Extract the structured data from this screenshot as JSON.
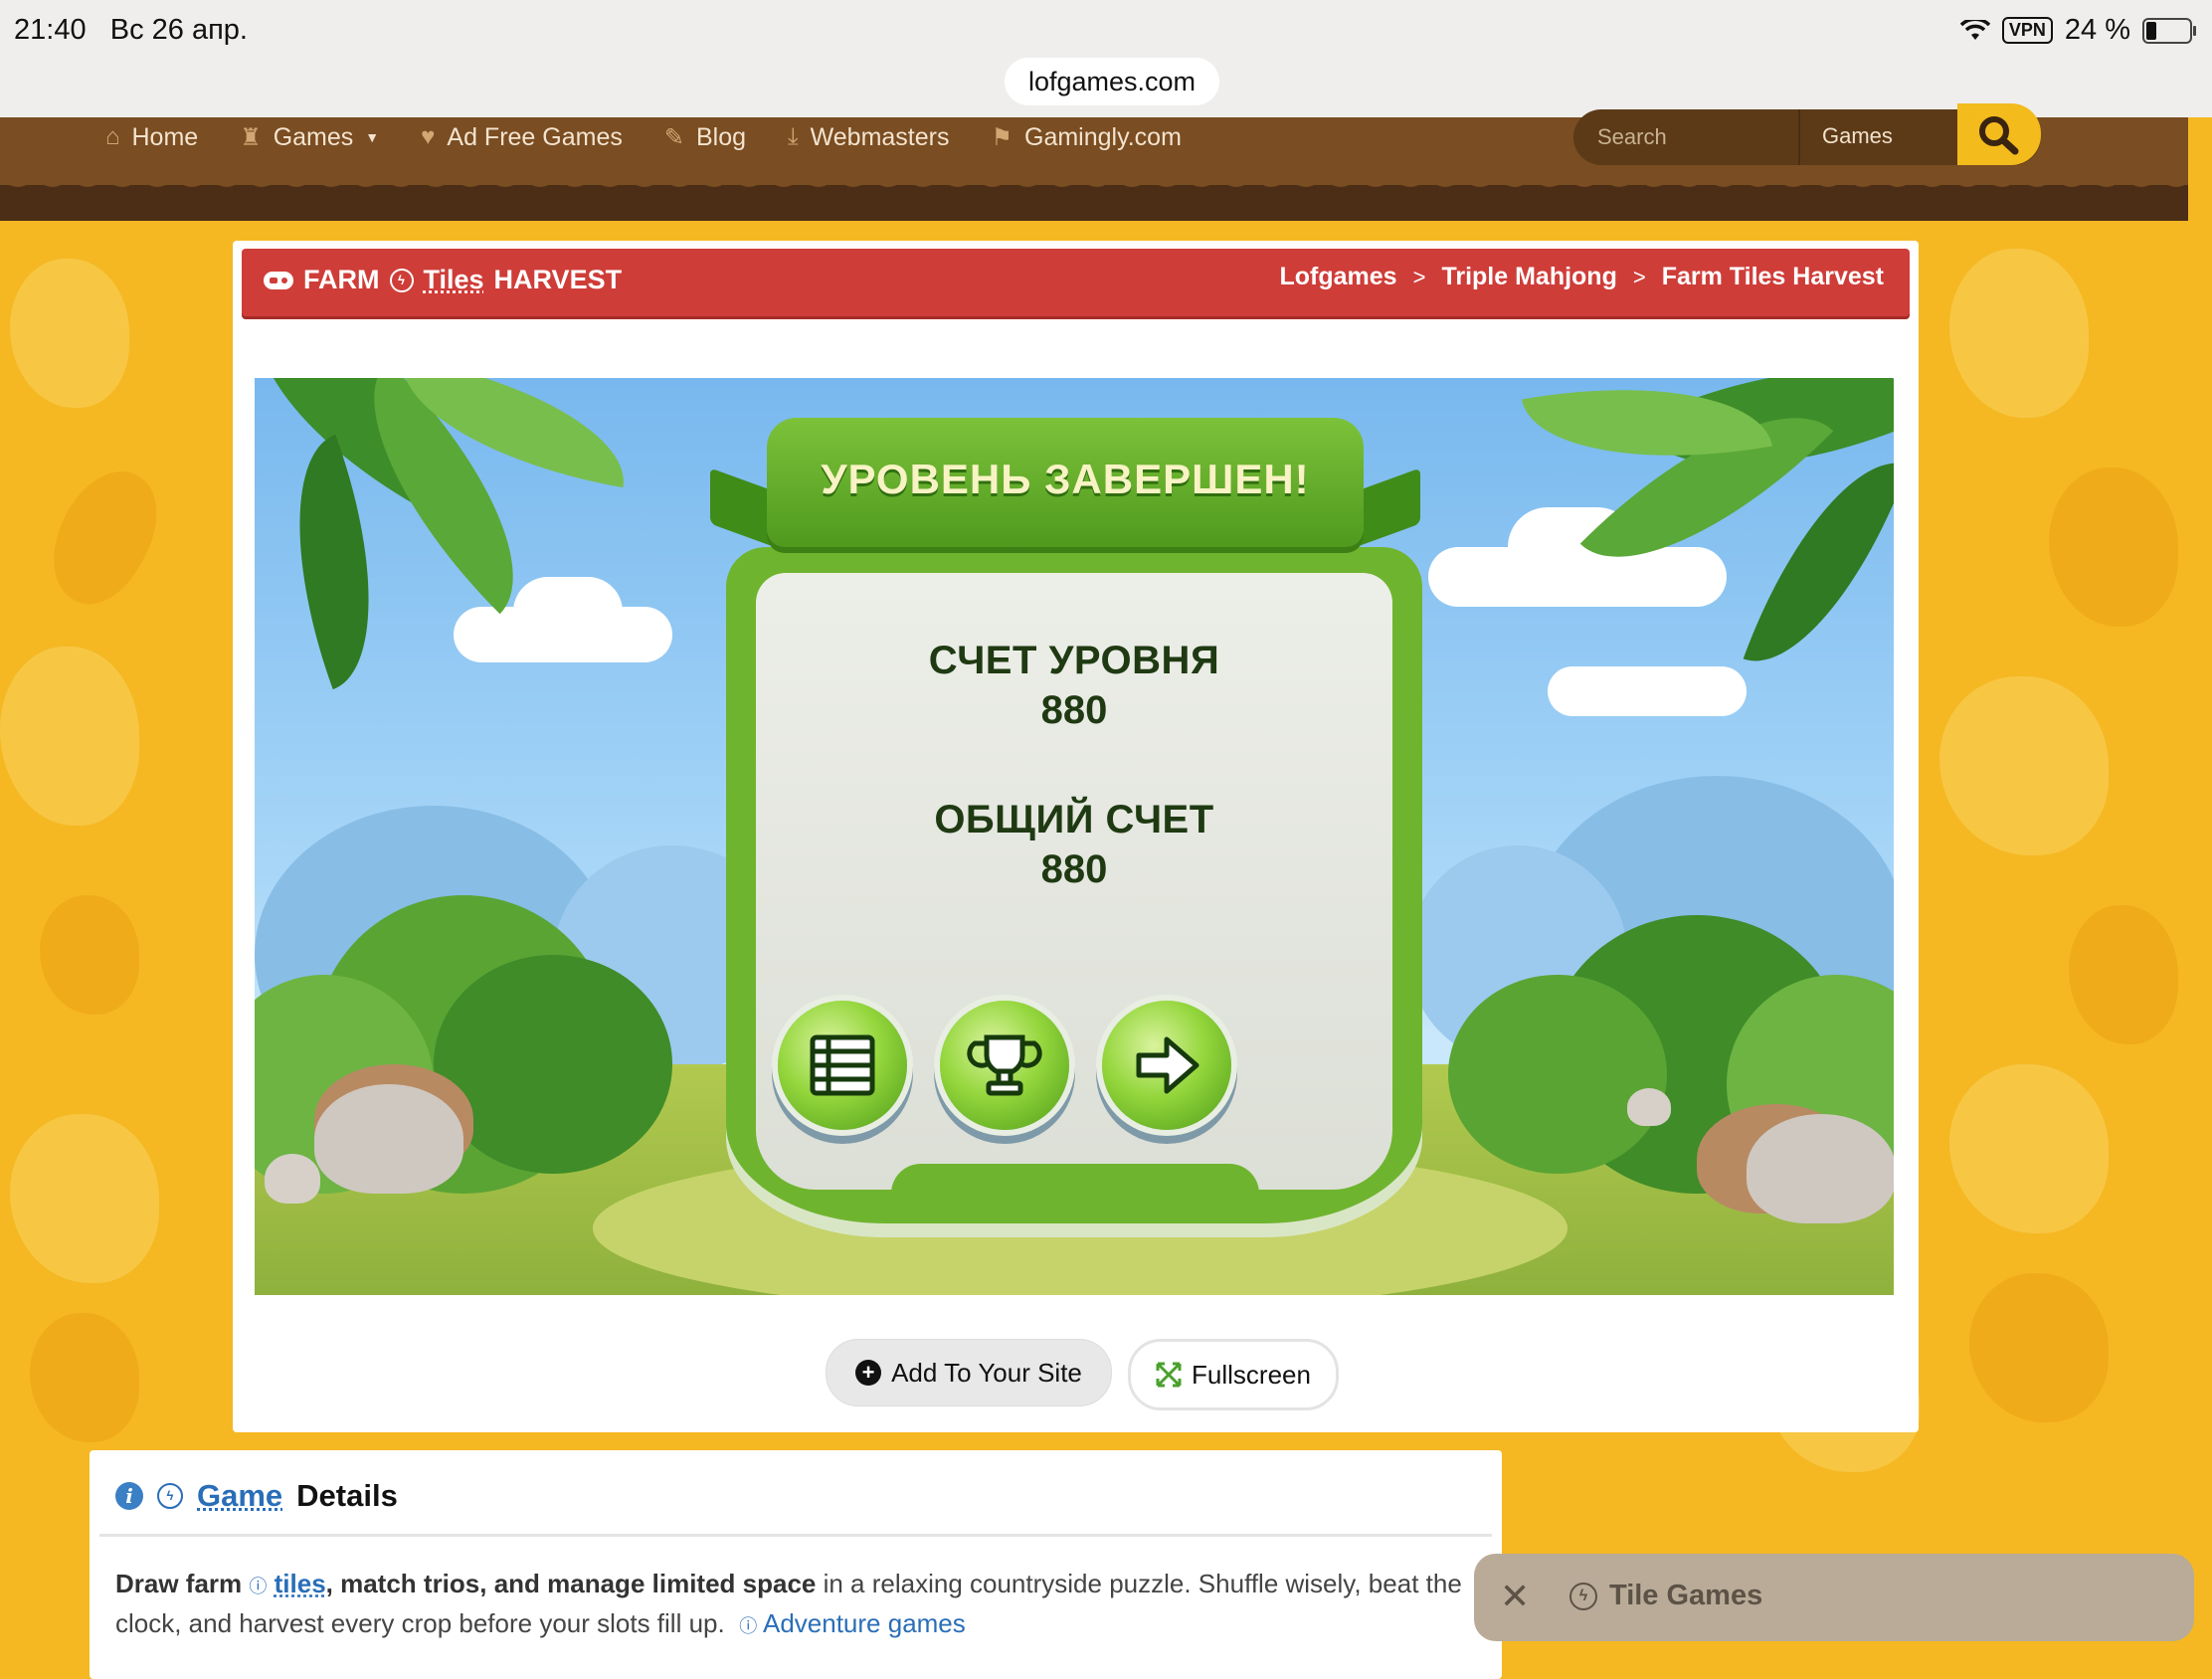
{
  "status_bar": {
    "time": "21:40",
    "date": "Вс 26 апр.",
    "vpn": "VPN",
    "battery": "24 %",
    "battery_level_percent": 24,
    "url": "lofgames.com"
  },
  "nav": {
    "items": [
      {
        "label": "Home",
        "icon": "home-icon"
      },
      {
        "label": "Games",
        "icon": "crown-icon",
        "dropdown": true
      },
      {
        "label": "Ad Free Games",
        "icon": "heart-icon"
      },
      {
        "label": "Blog",
        "icon": "pencil-icon"
      },
      {
        "label": "Webmasters",
        "icon": "download-icon"
      },
      {
        "label": "Gamingly.com",
        "icon": "bookmark-icon"
      }
    ],
    "search_placeholder": "Search",
    "search_category": "Games"
  },
  "title_bar": {
    "title_part1": "FARM",
    "title_link": "Tiles",
    "title_part2": "HARVEST",
    "breadcrumb": [
      "Lofgames",
      "Triple Mahjong",
      "Farm Tiles Harvest"
    ]
  },
  "game": {
    "banner": "УРОВЕНЬ ЗАВЕРШЕН!",
    "level_score_label": "СЧЕТ УРОВНЯ",
    "level_score": "880",
    "total_score_label": "ОБЩИЙ СЧЕТ",
    "total_score": "880",
    "buttons": [
      "menu-icon",
      "trophy-icon",
      "next-arrow-icon"
    ]
  },
  "actions": {
    "add_label": "Add To Your Site",
    "fullscreen_label": "Fullscreen"
  },
  "details": {
    "heading_link": "Game",
    "heading_rest": "Details",
    "desc_bold1": "Draw farm",
    "desc_link1": "tiles",
    "desc_bold2": ", match trios, and manage limited space",
    "desc_rest": " in a relaxing countryside puzzle. Shuffle wisely, beat the clock, and harvest every crop before your slots fill up.",
    "desc_link2": "Adventure games"
  },
  "toast": {
    "label": "Tile Games"
  },
  "colors": {
    "nav_brown": "#7a4d22",
    "title_red": "#cf3d39",
    "accent_yellow": "#f3bb1c",
    "link_blue": "#2a6eb8",
    "dialog_green": "#6fb42f"
  }
}
